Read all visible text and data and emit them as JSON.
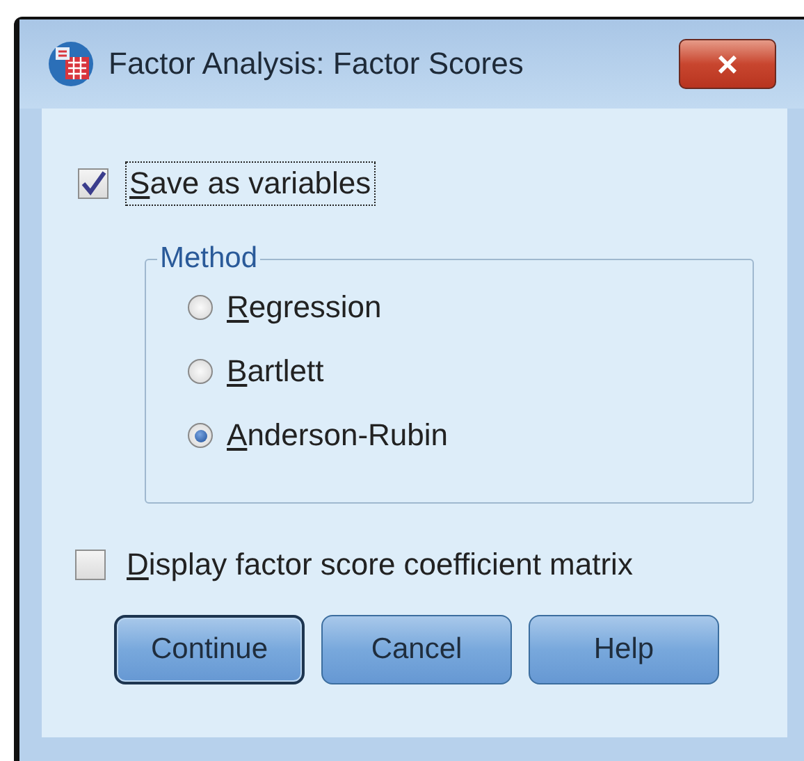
{
  "window": {
    "title": "Factor Analysis: Factor Scores",
    "close": "×"
  },
  "save_as_variables": {
    "label": "Save as variables",
    "checked": true,
    "focused": true
  },
  "method": {
    "legend": "Method",
    "options": [
      {
        "label": "Regression",
        "selected": false
      },
      {
        "label": "Bartlett",
        "selected": false
      },
      {
        "label": "Anderson-Rubin",
        "selected": true
      }
    ]
  },
  "display_matrix": {
    "label": "Display factor score coefficient matrix",
    "checked": false
  },
  "buttons": [
    {
      "label": "Continue",
      "default": true
    },
    {
      "label": "Cancel",
      "default": false
    },
    {
      "label": "Help",
      "default": false
    }
  ]
}
